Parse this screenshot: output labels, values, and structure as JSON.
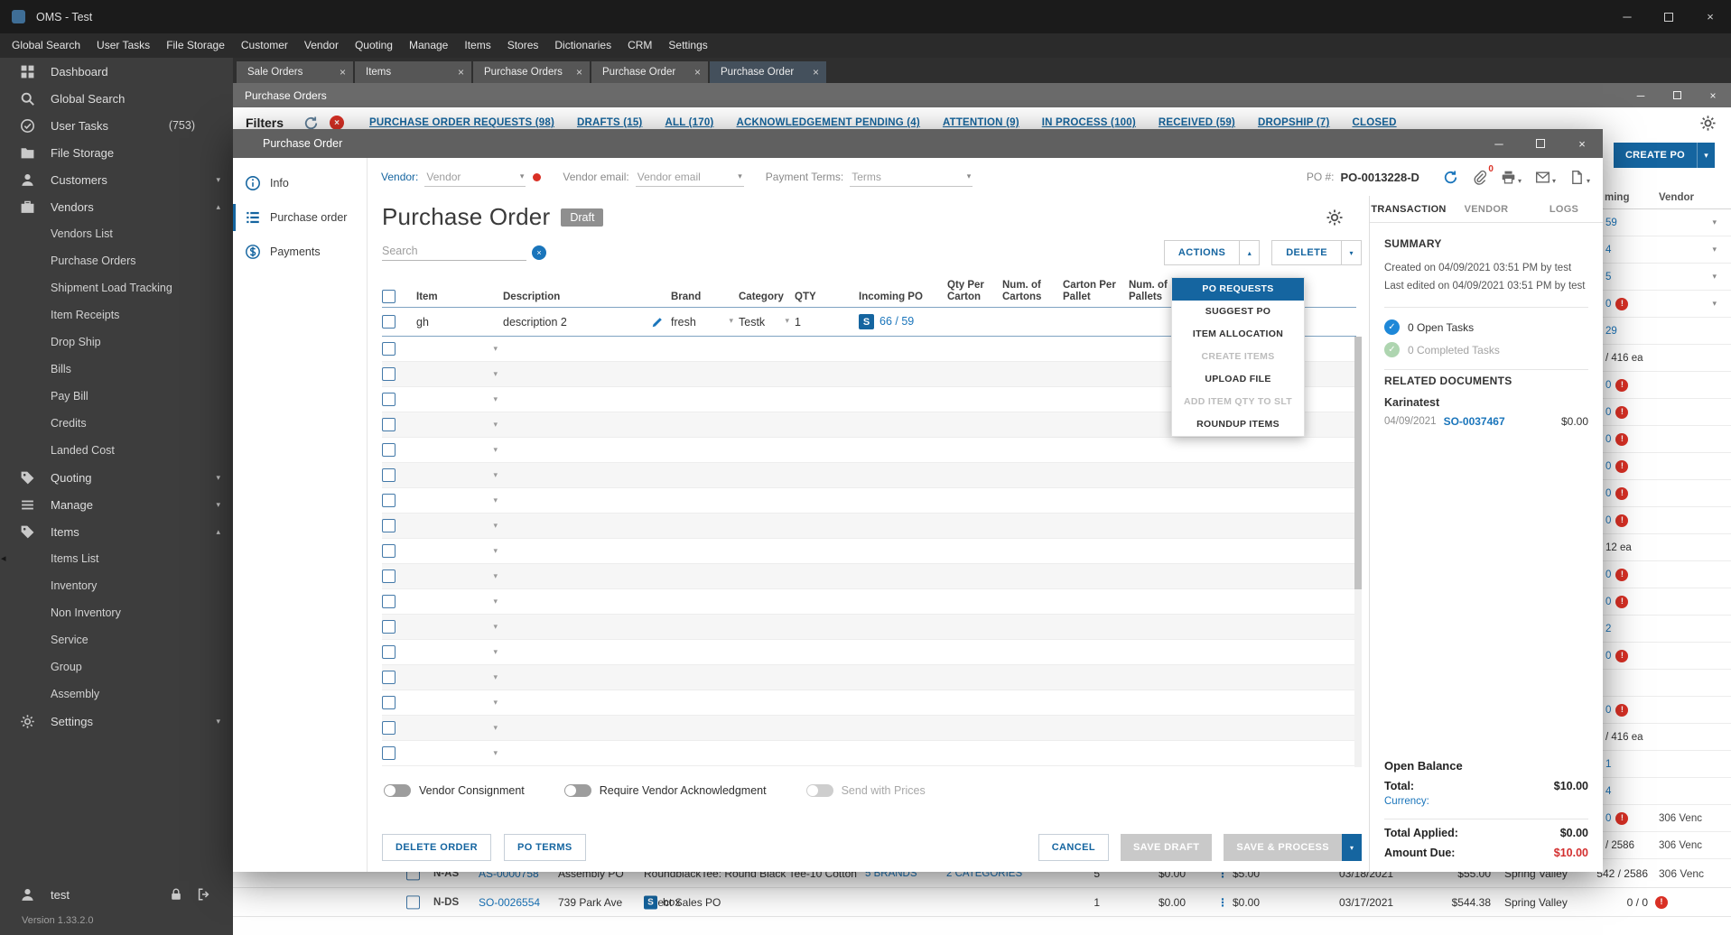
{
  "titlebar": {
    "title": "OMS - Test"
  },
  "menubar": {
    "items": [
      "Global Search",
      "User Tasks",
      "File Storage",
      "Customer",
      "Vendor",
      "Quoting",
      "Manage",
      "Items",
      "Stores",
      "Dictionaries",
      "CRM",
      "Settings"
    ]
  },
  "sidebar": {
    "items": [
      {
        "label": "Dashboard",
        "icon": "dashboard"
      },
      {
        "label": "Global Search",
        "icon": "search"
      },
      {
        "label": "User Tasks",
        "icon": "tasks",
        "badge": "(753)"
      },
      {
        "label": "File Storage",
        "icon": "folder"
      },
      {
        "label": "Customers",
        "icon": "customers",
        "chevron": "down"
      },
      {
        "label": "Vendors",
        "icon": "vendors",
        "chevron": "up"
      },
      {
        "label": "Vendors List",
        "indent": true
      },
      {
        "label": "Purchase Orders",
        "indent": true
      },
      {
        "label": "Shipment Load Tracking",
        "indent": true
      },
      {
        "label": "Item Receipts",
        "indent": true
      },
      {
        "label": "Drop Ship",
        "indent": true
      },
      {
        "label": "Bills",
        "indent": true
      },
      {
        "label": "Pay Bill",
        "indent": true
      },
      {
        "label": "Credits",
        "indent": true
      },
      {
        "label": "Landed Cost",
        "indent": true
      },
      {
        "label": "Quoting",
        "icon": "tag",
        "chevron": "down"
      },
      {
        "label": "Manage",
        "icon": "manage",
        "chevron": "down"
      },
      {
        "label": "Items",
        "icon": "tag",
        "chevron": "up"
      },
      {
        "label": "Items List",
        "indent": true
      },
      {
        "label": "Inventory",
        "indent": true
      },
      {
        "label": "Non Inventory",
        "indent": true
      },
      {
        "label": "Service",
        "indent": true
      },
      {
        "label": "Group",
        "indent": true
      },
      {
        "label": "Assembly",
        "indent": true
      },
      {
        "label": "Settings",
        "icon": "gear",
        "chevron": "down"
      }
    ],
    "user": "test",
    "version": "Version 1.33.2.0"
  },
  "doc_tabs": [
    {
      "label": "Sale Orders"
    },
    {
      "label": "Items"
    },
    {
      "label": "Purchase Orders"
    },
    {
      "label": "Purchase Order"
    },
    {
      "label": "Purchase Order",
      "active": true
    }
  ],
  "background": {
    "window_title": "Purchase Orders",
    "filters_label": "Filters",
    "filter_tabs": [
      "PURCHASE ORDER REQUESTS (98)",
      "DRAFTS (15)",
      "ALL (170)",
      "ACKNOWLEDGEMENT PENDING (4)",
      "ATTENTION (9)",
      "IN PROCESS (100)",
      "RECEIVED (59)",
      "DROPSHIP (7)",
      "CLOSED"
    ],
    "create_po_label": "CREATE PO",
    "partial_headers": [
      "ming",
      "Vendor"
    ],
    "strip_rows": [
      {
        "value": "59",
        "link": true,
        "caret": true
      },
      {
        "value": "4",
        "link": true,
        "caret": true
      },
      {
        "value": "5",
        "link": true,
        "caret": true
      },
      {
        "value": "0",
        "link": true,
        "error": true,
        "caret": true
      },
      {
        "value": "29",
        "link": true
      },
      {
        "value": "/ 416 ea",
        "link": false
      },
      {
        "value": "0",
        "link": true,
        "error": true
      },
      {
        "value": "0",
        "link": true,
        "error": true
      },
      {
        "value": "0",
        "link": true,
        "error": true
      },
      {
        "value": "0",
        "link": true,
        "error": true
      },
      {
        "value": "0",
        "link": true,
        "error": true
      },
      {
        "value": "0",
        "link": true,
        "error": true
      },
      {
        "value": "12 ea",
        "link": false
      },
      {
        "value": "0",
        "link": true,
        "error": true
      },
      {
        "value": "0",
        "link": true,
        "error": true
      },
      {
        "value": "2",
        "link": true
      },
      {
        "value": "0",
        "link": true,
        "error": true
      },
      {
        "value": ""
      },
      {
        "value": "0",
        "link": true,
        "error": true
      },
      {
        "value": "/ 416 ea",
        "link": false
      },
      {
        "value": "1",
        "link": true
      },
      {
        "value": "4",
        "link": true
      },
      {
        "value": "0",
        "link": true,
        "error": true,
        "vendor": "306 Venc"
      },
      {
        "value": "/ 2586",
        "link": false,
        "vendor": "306 Venc"
      }
    ],
    "bottom_rows": [
      {
        "error": false,
        "cells": [
          {
            "text": "N-AS",
            "kind": "type"
          },
          {
            "text": "AS-0000758",
            "kind": "link"
          },
          {
            "text": "Assembly PO",
            "kind": "name"
          },
          {
            "text": "RoundblackTee: Round Black Tee-10 Cotton",
            "kind": "desc"
          },
          {
            "text": "5 BRANDS",
            "kind": "blink"
          },
          {
            "text": "2 CATEGORIES",
            "kind": "clink"
          },
          {
            "text": "5",
            "kind": "num"
          },
          {
            "text": "$0.00",
            "kind": "money"
          },
          {
            "text": "$5.00",
            "kind": "money2",
            "icon": "dots"
          },
          {
            "text": "03/18/2021",
            "kind": "date"
          },
          {
            "text": "$55.00",
            "kind": "money3"
          },
          {
            "text": "Spring Valley",
            "kind": "vendor"
          },
          {
            "text": "542 / 2586",
            "kind": "frac"
          },
          {
            "text": "306 Venc",
            "kind": "vendor2"
          }
        ]
      },
      {
        "error": true,
        "cells": [
          {
            "text": "N-DS",
            "kind": "type"
          },
          {
            "text": "SO-0026554",
            "kind": "link"
          },
          {
            "text": "739 Park Ave",
            "kind": "name"
          },
          {
            "text": "Direct Sales PO",
            "kind": "desc"
          },
          {
            "text": "box",
            "kind": "box"
          },
          {
            "text": "1",
            "kind": "num"
          },
          {
            "text": "$0.00",
            "kind": "money"
          },
          {
            "text": "$0.00",
            "kind": "money2",
            "icon": "dots"
          },
          {
            "text": "03/17/2021",
            "kind": "date"
          },
          {
            "text": "$544.38",
            "kind": "money3"
          },
          {
            "text": "Spring Valley",
            "kind": "vendor"
          },
          {
            "text": "0 / 0",
            "kind": "frac"
          }
        ]
      }
    ]
  },
  "modal": {
    "title": "Purchase Order",
    "nav": [
      {
        "label": "Info",
        "icon": "info"
      },
      {
        "label": "Purchase order",
        "icon": "listdoc",
        "active": true
      },
      {
        "label": "Payments",
        "icon": "dollar"
      }
    ],
    "heading": "Purchase Order",
    "status_badge": "Draft",
    "search_placeholder": "Search",
    "actions_label": "ACTIONS",
    "delete_label": "DELETE",
    "actions_menu": [
      {
        "label": "PO REQUESTS",
        "state": "active"
      },
      {
        "label": "SUGGEST PO",
        "state": "normal"
      },
      {
        "label": "ITEM ALLOCATION",
        "state": "normal"
      },
      {
        "label": "CREATE ITEMS",
        "state": "disabled"
      },
      {
        "label": "UPLOAD FILE",
        "state": "normal"
      },
      {
        "label": "ADD ITEM QTY TO SLT",
        "state": "disabled"
      },
      {
        "label": "ROUNDUP ITEMS",
        "state": "normal"
      }
    ],
    "table": {
      "columns": [
        "Item",
        "Description",
        "Brand",
        "Category",
        "QTY",
        "Incoming PO",
        "Qty Per Carton",
        "Num. of Cartons",
        "Carton Per Pallet",
        "Num. of Pallets"
      ],
      "row": {
        "item": "gh",
        "description": "description 2",
        "brand": "fresh",
        "category": "Testk",
        "qty": "1",
        "incoming_badge": "S",
        "incoming": "66 / 59"
      },
      "empty_row_count": 17
    },
    "toggles": [
      {
        "label": "Vendor Consignment",
        "disabled": false
      },
      {
        "label": "Require Vendor Acknowledgment",
        "disabled": false
      },
      {
        "label": "Send with Prices",
        "disabled": true
      }
    ],
    "footer": {
      "delete_order": "DELETE ORDER",
      "po_terms": "PO TERMS",
      "cancel": "CANCEL",
      "save_draft": "SAVE DRAFT",
      "save_process": "SAVE & PROCESS"
    }
  },
  "form": {
    "vendor_label": "Vendor:",
    "vendor_placeholder": "Vendor",
    "email_label": "Vendor email:",
    "email_placeholder": "Vendor email",
    "terms_label": "Payment Terms:",
    "terms_placeholder": "Terms",
    "po_label": "PO #:",
    "po_number": "PO-0013228-D",
    "attachments_count": "0"
  },
  "panel": {
    "tabs": [
      "TRANSACTION",
      "VENDOR",
      "LOGS"
    ],
    "summary_title": "SUMMARY",
    "created": "Created on 04/09/2021 03:51 PM by test",
    "edited": "Last edited on 04/09/2021 03:51 PM by test",
    "open_tasks": "0 Open Tasks",
    "completed_tasks": "0 Completed Tasks",
    "related_title": "RELATED DOCUMENTS",
    "related_customer": "Karinatest",
    "related_date": "04/09/2021",
    "related_doc": "SO-0037467",
    "related_amount": "$0.00",
    "balance_title": "Open Balance",
    "total_label": "Total:",
    "total_value": "$10.00",
    "currency_label": "Currency:",
    "applied_label": "Total Applied:",
    "applied_value": "$0.00",
    "due_label": "Amount Due:",
    "due_value": "$10.00"
  }
}
